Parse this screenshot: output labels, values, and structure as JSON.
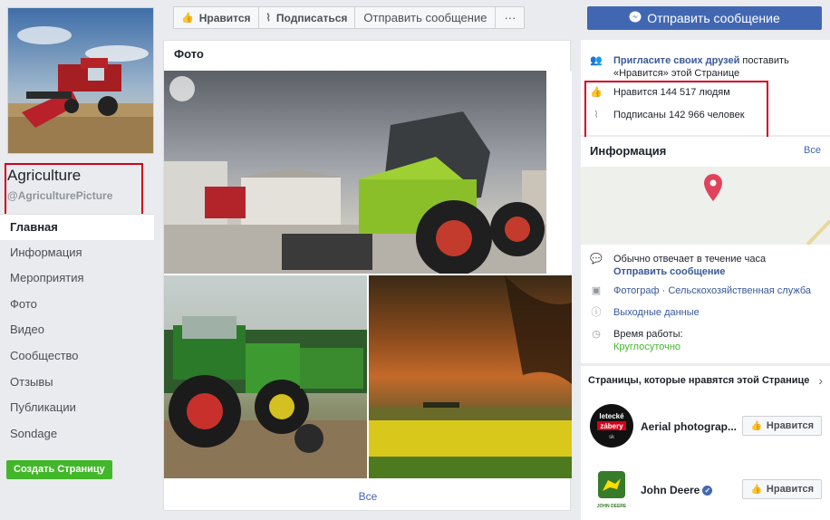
{
  "page": {
    "name": "Agriculture",
    "handle": "@AgriculturePicture"
  },
  "nav": {
    "items": [
      "Главная",
      "Информация",
      "Мероприятия",
      "Фото",
      "Видео",
      "Сообщество",
      "Отзывы",
      "Публикации",
      "Sondage"
    ],
    "create_page": "Создать Страницу"
  },
  "actionbar": {
    "like": "Нравится",
    "follow": "Подписаться",
    "send_message": "Отправить сообщение",
    "more": "···"
  },
  "message_button": "Отправить сообщение",
  "photos": {
    "title": "Фото",
    "see_all": "Все"
  },
  "community": {
    "invite_link": "Пригласите своих друзей",
    "invite_rest": " поставить «Нравится» этой Странице",
    "likes": "Нравится 144 517 людям",
    "follows": "Подписаны 142 966 человек"
  },
  "info": {
    "title": "Информация",
    "see_all": "Все",
    "response": "Обычно отвечает в течение часа",
    "send_message": "Отправить сообщение",
    "categories": "Фотограф · Сельскохозяйственная служба",
    "holidays": "Выходные данные",
    "hours_label": "Время работы:",
    "hours_value": "Круглосуточно"
  },
  "liked_pages": {
    "title": "Страницы, которые нравятся этой Странице",
    "pages": [
      {
        "name": "Aerial photograp...",
        "like": "Нравится",
        "logo_text": [
          "letecké",
          "zábery",
          "sk"
        ]
      },
      {
        "name": "John Deere",
        "like": "Нравится",
        "logo_text": "JOHN DEERE"
      }
    ]
  },
  "colors": {
    "facebook_blue": "#4267b2",
    "link_blue": "#385898",
    "green": "#42b72a",
    "highlight_red": "#d0021b"
  }
}
